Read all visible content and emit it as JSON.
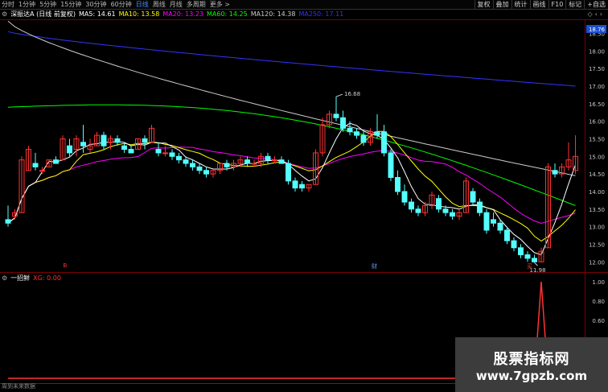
{
  "toolbar": {
    "periods": [
      "分时",
      "1分钟",
      "5分钟",
      "15分钟",
      "30分钟",
      "60分钟",
      "日线",
      "周线",
      "月线",
      "多周期",
      "更多 >"
    ],
    "active_period": "日线",
    "right_buttons": [
      "复权",
      "叠加",
      "统计",
      "画线",
      "F10",
      "标记",
      "+自选"
    ]
  },
  "legend": {
    "title": "深振达A (日线 前复权)",
    "ma5": "MA5: 14.61",
    "ma10": "MA10: 13.58",
    "ma20": "MA20: 13.23",
    "ma60": "MA60: 14.25",
    "ma120": "MA120: 14.38",
    "ma250": "MA250: 17.11"
  },
  "colors": {
    "up": "#ff3232",
    "down": "#54ffff",
    "ma5": "#ffffff",
    "ma10": "#ffff00",
    "ma20": "#ff00ff",
    "ma60": "#00ff00",
    "ma120": "#cccccc",
    "ma250": "#3333ff",
    "grid": "#7a0000",
    "price_tag": "#1a4fd0"
  },
  "corner_icons": [
    "diamond-icon",
    "chevron-left-icon",
    "chevron-right-icon"
  ],
  "price_axis": {
    "current_tag": "18.76",
    "ticks": [
      "18.50",
      "18.00",
      "17.50",
      "17.00",
      "16.50",
      "16.00",
      "15.50",
      "15.00",
      "14.50",
      "14.00",
      "13.50",
      "13.00",
      "12.50",
      "12.00"
    ]
  },
  "annotations": {
    "high": "16.68",
    "low": "11.98",
    "marker_left": "B",
    "marker_mid": "财",
    "marker_right": "买"
  },
  "indicator": {
    "name": "一招鲜",
    "value": "XG: 0.00",
    "ticks": [
      "1.00",
      "0.80",
      "0.60",
      "0.40",
      "0.20"
    ]
  },
  "status_text": "周到未来数据",
  "watermark": {
    "line1": "股票指标网",
    "line2": "www.7gpzb.com"
  },
  "chart_data": {
    "type": "candlestick",
    "y_range": [
      11.8,
      18.9
    ],
    "sell_signal_index": 1,
    "buy_signal_index": 78,
    "candles": [
      {
        "o": 13.2,
        "h": 13.6,
        "l": 13.0,
        "c": 13.1
      },
      {
        "o": 13.3,
        "h": 13.5,
        "l": 13.2,
        "c": 13.4
      },
      {
        "o": 13.4,
        "h": 15.0,
        "l": 13.4,
        "c": 14.9
      },
      {
        "o": 14.6,
        "h": 15.3,
        "l": 14.6,
        "c": 15.2
      },
      {
        "o": 14.8,
        "h": 15.1,
        "l": 14.6,
        "c": 14.7
      },
      {
        "o": 14.6,
        "h": 14.7,
        "l": 14.5,
        "c": 14.6
      },
      {
        "o": 14.7,
        "h": 14.9,
        "l": 14.7,
        "c": 14.9
      },
      {
        "o": 14.9,
        "h": 15.0,
        "l": 14.8,
        "c": 14.8
      },
      {
        "o": 14.9,
        "h": 15.6,
        "l": 14.9,
        "c": 15.5
      },
      {
        "o": 15.3,
        "h": 15.5,
        "l": 15.0,
        "c": 15.1
      },
      {
        "o": 15.2,
        "h": 15.6,
        "l": 15.0,
        "c": 15.5
      },
      {
        "o": 15.4,
        "h": 15.9,
        "l": 15.1,
        "c": 15.3
      },
      {
        "o": 15.2,
        "h": 15.5,
        "l": 15.1,
        "c": 15.3
      },
      {
        "o": 15.3,
        "h": 15.7,
        "l": 15.3,
        "c": 15.6
      },
      {
        "o": 15.6,
        "h": 15.7,
        "l": 15.2,
        "c": 15.3
      },
      {
        "o": 15.4,
        "h": 15.6,
        "l": 15.2,
        "c": 15.5
      },
      {
        "o": 15.5,
        "h": 15.6,
        "l": 15.3,
        "c": 15.4
      },
      {
        "o": 15.3,
        "h": 15.4,
        "l": 15.1,
        "c": 15.2
      },
      {
        "o": 15.2,
        "h": 15.3,
        "l": 15.1,
        "c": 15.1
      },
      {
        "o": 15.2,
        "h": 15.5,
        "l": 15.2,
        "c": 15.5
      },
      {
        "o": 15.5,
        "h": 15.6,
        "l": 15.2,
        "c": 15.4
      },
      {
        "o": 15.4,
        "h": 15.9,
        "l": 15.4,
        "c": 15.8
      },
      {
        "o": 15.2,
        "h": 15.4,
        "l": 15.0,
        "c": 15.1
      },
      {
        "o": 15.1,
        "h": 15.3,
        "l": 15.0,
        "c": 15.1
      },
      {
        "o": 15.1,
        "h": 15.2,
        "l": 14.9,
        "c": 15.0
      },
      {
        "o": 15.0,
        "h": 15.1,
        "l": 14.8,
        "c": 14.9
      },
      {
        "o": 14.9,
        "h": 15.0,
        "l": 14.7,
        "c": 14.8
      },
      {
        "o": 14.8,
        "h": 14.9,
        "l": 14.6,
        "c": 14.7
      },
      {
        "o": 14.7,
        "h": 14.8,
        "l": 14.5,
        "c": 14.6
      },
      {
        "o": 14.6,
        "h": 14.7,
        "l": 14.4,
        "c": 14.5
      },
      {
        "o": 14.5,
        "h": 14.6,
        "l": 14.4,
        "c": 14.6
      },
      {
        "o": 14.6,
        "h": 14.8,
        "l": 14.5,
        "c": 14.8
      },
      {
        "o": 14.8,
        "h": 14.9,
        "l": 14.6,
        "c": 14.7
      },
      {
        "o": 14.7,
        "h": 14.9,
        "l": 14.6,
        "c": 14.8
      },
      {
        "o": 14.8,
        "h": 15.0,
        "l": 14.7,
        "c": 14.9
      },
      {
        "o": 14.9,
        "h": 15.0,
        "l": 14.7,
        "c": 14.8
      },
      {
        "o": 14.8,
        "h": 14.9,
        "l": 14.7,
        "c": 14.8
      },
      {
        "o": 14.8,
        "h": 15.1,
        "l": 14.7,
        "c": 15.0
      },
      {
        "o": 15.0,
        "h": 15.1,
        "l": 14.8,
        "c": 14.9
      },
      {
        "o": 14.9,
        "h": 15.0,
        "l": 14.8,
        "c": 14.9
      },
      {
        "o": 14.9,
        "h": 15.0,
        "l": 14.8,
        "c": 14.8
      },
      {
        "o": 14.8,
        "h": 14.9,
        "l": 14.2,
        "c": 14.3
      },
      {
        "o": 14.3,
        "h": 14.4,
        "l": 14.0,
        "c": 14.1
      },
      {
        "o": 14.2,
        "h": 14.3,
        "l": 14.0,
        "c": 14.1
      },
      {
        "o": 14.1,
        "h": 14.2,
        "l": 14.0,
        "c": 14.2
      },
      {
        "o": 14.2,
        "h": 15.2,
        "l": 14.2,
        "c": 15.1
      },
      {
        "o": 15.1,
        "h": 16.1,
        "l": 15.0,
        "c": 15.9
      },
      {
        "o": 15.9,
        "h": 16.3,
        "l": 15.8,
        "c": 16.2
      },
      {
        "o": 16.2,
        "h": 16.7,
        "l": 16.0,
        "c": 16.1
      },
      {
        "o": 16.1,
        "h": 16.3,
        "l": 15.7,
        "c": 15.8
      },
      {
        "o": 15.8,
        "h": 16.0,
        "l": 15.6,
        "c": 15.7
      },
      {
        "o": 15.7,
        "h": 15.8,
        "l": 15.5,
        "c": 15.6
      },
      {
        "o": 15.6,
        "h": 15.7,
        "l": 15.3,
        "c": 15.4
      },
      {
        "o": 15.4,
        "h": 15.8,
        "l": 15.3,
        "c": 15.7
      },
      {
        "o": 15.7,
        "h": 16.2,
        "l": 15.5,
        "c": 15.6
      },
      {
        "o": 15.7,
        "h": 15.9,
        "l": 15.0,
        "c": 15.1
      },
      {
        "o": 15.1,
        "h": 15.2,
        "l": 14.3,
        "c": 14.4
      },
      {
        "o": 14.4,
        "h": 14.6,
        "l": 13.9,
        "c": 14.0
      },
      {
        "o": 14.0,
        "h": 14.2,
        "l": 13.6,
        "c": 13.7
      },
      {
        "o": 13.7,
        "h": 13.8,
        "l": 13.4,
        "c": 13.5
      },
      {
        "o": 13.5,
        "h": 13.6,
        "l": 13.3,
        "c": 13.4
      },
      {
        "o": 13.4,
        "h": 13.7,
        "l": 13.3,
        "c": 13.6
      },
      {
        "o": 13.6,
        "h": 14.0,
        "l": 13.5,
        "c": 13.9
      },
      {
        "o": 13.8,
        "h": 13.9,
        "l": 13.4,
        "c": 13.5
      },
      {
        "o": 13.5,
        "h": 13.6,
        "l": 13.3,
        "c": 13.4
      },
      {
        "o": 13.4,
        "h": 13.5,
        "l": 13.2,
        "c": 13.3
      },
      {
        "o": 13.3,
        "h": 13.5,
        "l": 13.2,
        "c": 13.4
      },
      {
        "o": 13.4,
        "h": 14.4,
        "l": 13.4,
        "c": 14.3
      },
      {
        "o": 14.0,
        "h": 14.1,
        "l": 13.6,
        "c": 13.7
      },
      {
        "o": 13.7,
        "h": 13.8,
        "l": 13.3,
        "c": 13.4
      },
      {
        "o": 13.4,
        "h": 13.5,
        "l": 12.8,
        "c": 12.9
      },
      {
        "o": 13.2,
        "h": 13.4,
        "l": 13.0,
        "c": 13.1
      },
      {
        "o": 13.1,
        "h": 13.2,
        "l": 12.8,
        "c": 12.9
      },
      {
        "o": 12.9,
        "h": 13.0,
        "l": 12.5,
        "c": 12.6
      },
      {
        "o": 12.6,
        "h": 12.7,
        "l": 12.3,
        "c": 12.4
      },
      {
        "o": 12.4,
        "h": 12.5,
        "l": 12.1,
        "c": 12.2
      },
      {
        "o": 12.2,
        "h": 12.3,
        "l": 12.0,
        "c": 12.1
      },
      {
        "o": 12.1,
        "h": 12.2,
        "l": 11.98,
        "c": 12.0
      },
      {
        "o": 12.0,
        "h": 12.4,
        "l": 12.0,
        "c": 12.3
      },
      {
        "o": 12.4,
        "h": 14.8,
        "l": 12.4,
        "c": 14.7
      },
      {
        "o": 14.6,
        "h": 14.8,
        "l": 14.4,
        "c": 14.5
      },
      {
        "o": 14.5,
        "h": 14.8,
        "l": 14.4,
        "c": 14.7
      },
      {
        "o": 14.7,
        "h": 15.4,
        "l": 14.6,
        "c": 14.9
      },
      {
        "o": 14.6,
        "h": 15.6,
        "l": 14.5,
        "c": 15.0
      }
    ]
  }
}
